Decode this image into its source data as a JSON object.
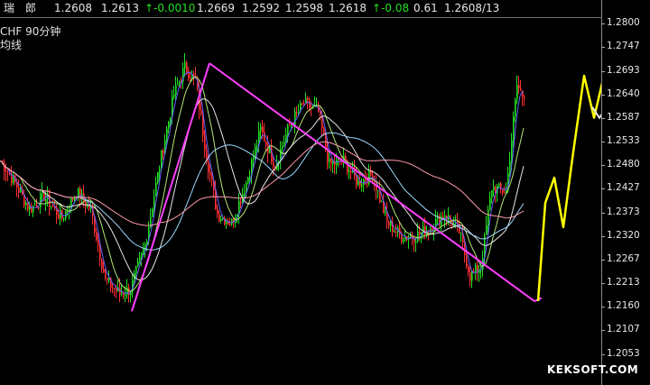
{
  "quote": {
    "title": "瑞　郎",
    "values": [
      "1.2608",
      "1.2613"
    ],
    "change": "↑-0.0010",
    "values2": [
      "1.2669",
      "1.2592",
      "1.2598",
      "1.2618"
    ],
    "pct": "↑-0.08",
    "extra": "0.61",
    "last": "1.2608/13"
  },
  "symbol_label": "CHF  90分钟",
  "sub_label": "均线",
  "watermark": "KEKSOFT.COM",
  "colors": {
    "up": "#22e022",
    "down": "#ff3030",
    "trendline": "#ff40ff",
    "forecast": "#ffff00",
    "ma_blue": "#6464ff",
    "ma_green": "#b4e678",
    "ma_white": "#e6e6e6",
    "ma_pink": "#ff9aaa",
    "ma_cyan": "#9ad8ff"
  },
  "chart_data": {
    "type": "line",
    "title": "CHF 90分钟",
    "xlabel": "",
    "ylabel": "",
    "ylim": [
      1.2025,
      1.2815
    ],
    "y_ticks": [
      "1.2800",
      "1.2747",
      "1.2693",
      "1.2640",
      "1.2587",
      "1.2533",
      "1.2480",
      "1.2427",
      "1.2373",
      "1.2320",
      "1.2267",
      "1.2213",
      "1.2160",
      "1.2107",
      "1.2053"
    ],
    "grid": false,
    "n_bars": 300,
    "price_path": [
      {
        "i": 0,
        "v": 1.249
      },
      {
        "i": 8,
        "v": 1.244
      },
      {
        "i": 16,
        "v": 1.238
      },
      {
        "i": 24,
        "v": 1.241
      },
      {
        "i": 34,
        "v": 1.236
      },
      {
        "i": 42,
        "v": 1.242
      },
      {
        "i": 50,
        "v": 1.238
      },
      {
        "i": 58,
        "v": 1.222
      },
      {
        "i": 66,
        "v": 1.219
      },
      {
        "i": 72,
        "v": 1.22
      },
      {
        "i": 80,
        "v": 1.23
      },
      {
        "i": 88,
        "v": 1.248
      },
      {
        "i": 96,
        "v": 1.264
      },
      {
        "i": 102,
        "v": 1.27
      },
      {
        "i": 108,
        "v": 1.267
      },
      {
        "i": 114,
        "v": 1.25
      },
      {
        "i": 120,
        "v": 1.237
      },
      {
        "i": 128,
        "v": 1.235
      },
      {
        "i": 136,
        "v": 1.244
      },
      {
        "i": 144,
        "v": 1.256
      },
      {
        "i": 152,
        "v": 1.248
      },
      {
        "i": 160,
        "v": 1.257
      },
      {
        "i": 168,
        "v": 1.262
      },
      {
        "i": 176,
        "v": 1.26
      },
      {
        "i": 182,
        "v": 1.248
      },
      {
        "i": 190,
        "v": 1.249
      },
      {
        "i": 198,
        "v": 1.244
      },
      {
        "i": 206,
        "v": 1.246
      },
      {
        "i": 214,
        "v": 1.235
      },
      {
        "i": 222,
        "v": 1.232
      },
      {
        "i": 230,
        "v": 1.232
      },
      {
        "i": 238,
        "v": 1.234
      },
      {
        "i": 246,
        "v": 1.237
      },
      {
        "i": 254,
        "v": 1.233
      },
      {
        "i": 260,
        "v": 1.223
      },
      {
        "i": 266,
        "v": 1.225
      },
      {
        "i": 272,
        "v": 1.243
      },
      {
        "i": 280,
        "v": 1.242
      },
      {
        "i": 286,
        "v": 1.266
      },
      {
        "i": 290,
        "v": 1.263
      }
    ],
    "series": [
      {
        "type": "candles",
        "bar_range": [
          0,
          290
        ]
      },
      {
        "type": "ma",
        "key": "ma_blue",
        "period": 5
      },
      {
        "type": "ma",
        "key": "ma_green",
        "period": 12
      },
      {
        "type": "ma",
        "key": "ma_white",
        "period": 24
      },
      {
        "type": "ma",
        "key": "ma_cyan",
        "period": 45
      },
      {
        "type": "ma",
        "key": "ma_pink",
        "period": 90
      }
    ],
    "trendlines": [
      {
        "from": {
          "i": 73,
          "v": 1.215
        },
        "to": {
          "i": 116,
          "v": 1.271
        }
      },
      {
        "from": {
          "i": 116,
          "v": 1.271
        },
        "to": {
          "i": 296,
          "v": 1.2173
        }
      },
      {
        "from": {
          "i": 296,
          "v": 1.2173
        },
        "to": {
          "i": 300,
          "v": 1.218
        }
      }
    ],
    "forecast_path": [
      {
        "x": 596,
        "v": 1.2173
      },
      {
        "x": 604,
        "v": 1.2395
      },
      {
        "x": 614,
        "v": 1.2452
      },
      {
        "x": 624,
        "v": 1.234
      },
      {
        "x": 634,
        "v": 1.2495
      },
      {
        "x": 647,
        "v": 1.2682
      },
      {
        "x": 658,
        "v": 1.2587
      },
      {
        "x": 671,
        "v": 1.27
      },
      {
        "x": 689,
        "v": 1.28
      }
    ],
    "forecast_arrow_v": 1.2595
  }
}
